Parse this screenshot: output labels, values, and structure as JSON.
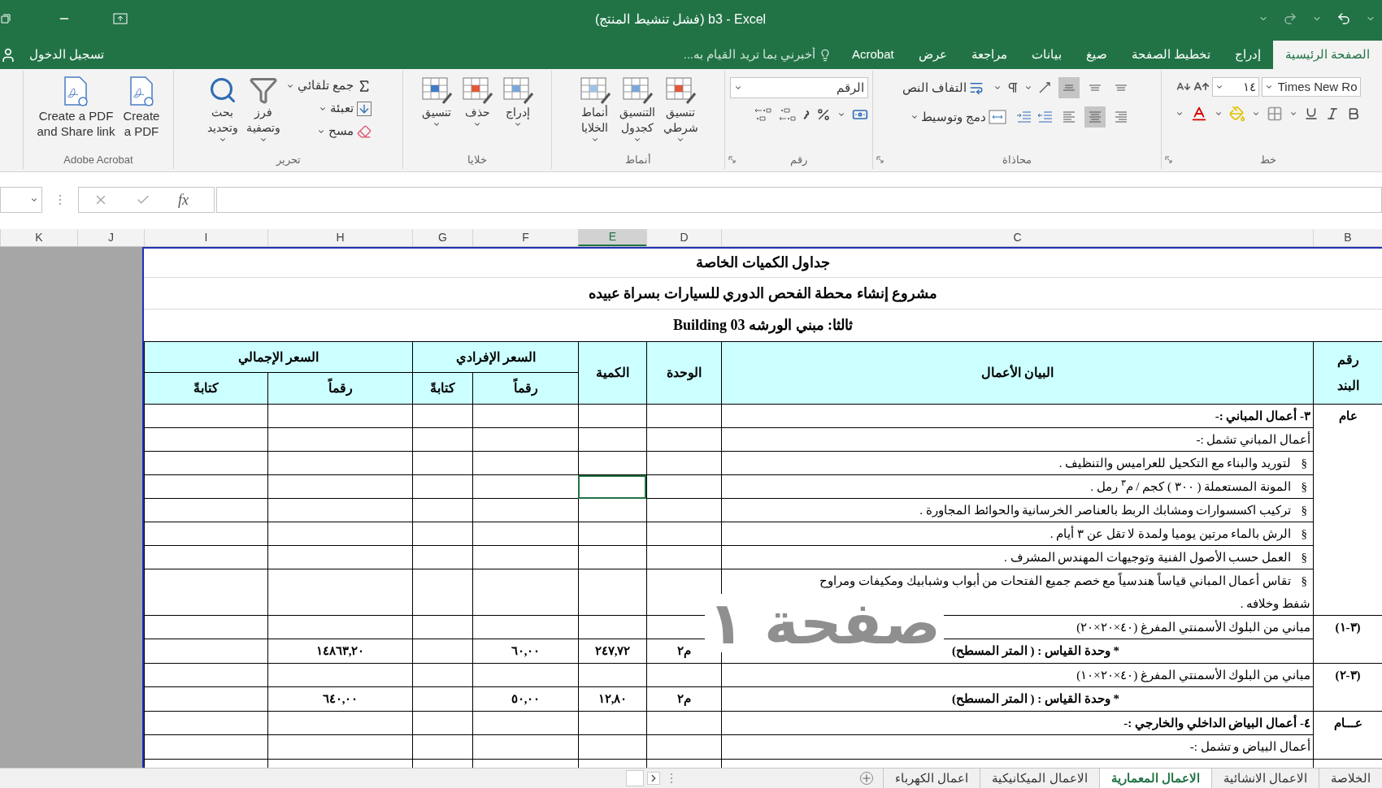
{
  "window": {
    "title": "(فشل تنشيط المنتج) b3 - Excel"
  },
  "ribbon_tabs": [
    {
      "label": "الصفحة الرئيسية",
      "selected": true
    },
    {
      "label": "إدراج",
      "selected": false
    },
    {
      "label": "تخطيط الصفحة",
      "selected": false
    },
    {
      "label": "صيغ",
      "selected": false
    },
    {
      "label": "بيانات",
      "selected": false
    },
    {
      "label": "مراجعة",
      "selected": false
    },
    {
      "label": "عرض",
      "selected": false
    },
    {
      "label": "Acrobat",
      "selected": false
    }
  ],
  "tell_me": {
    "placeholder": "أخبرني بما تريد القيام به..."
  },
  "sign_in": "تسجيل الدخول",
  "font_group": {
    "label": "خط",
    "font_name": "Times New Ro",
    "font_size": "١٤"
  },
  "alignment_group": {
    "label": "محاذاة",
    "wrap_text": "التفاف النص",
    "merge_center": "دمج وتوسيط",
    "vertical": [
      {
        "kind": "top",
        "selected": false
      },
      {
        "kind": "middle",
        "selected": false
      },
      {
        "kind": "bottom",
        "selected": true
      }
    ],
    "horizontal": [
      {
        "kind": "right",
        "selected": false
      },
      {
        "kind": "center",
        "selected": true
      },
      {
        "kind": "left",
        "selected": false
      }
    ]
  },
  "number_group": {
    "label": "رقم",
    "format": "الرقم"
  },
  "styles_group": {
    "label": "أنماط",
    "buttons": [
      "تنسيق\nشرطي",
      "التنسيق\nكجدول",
      "أنماط\nالخلايا"
    ]
  },
  "cells_group": {
    "label": "خلايا",
    "buttons": [
      "إدراج",
      "حذف",
      "تنسيق"
    ]
  },
  "editing_group": {
    "label": "تحرير",
    "small_buttons": [
      "جمع تلقائي",
      "تعبئة",
      "مسح"
    ],
    "big_buttons": [
      "فرز\nوتصفية",
      "بحث\nوتحديد"
    ]
  },
  "acrobat_group": {
    "label": "Adobe Acrobat",
    "buttons": [
      "Create\na PDF",
      "Create a PDF\nand Share link"
    ]
  },
  "formula_bar": {
    "function_label": "fx"
  },
  "columns": [
    {
      "label": "B",
      "selected": false
    },
    {
      "label": "C",
      "selected": false
    },
    {
      "label": "D",
      "selected": false
    },
    {
      "label": "E",
      "selected": true
    },
    {
      "label": "F",
      "selected": false
    },
    {
      "label": "G",
      "selected": false
    },
    {
      "label": "H",
      "selected": false
    },
    {
      "label": "I",
      "selected": false
    },
    {
      "label": "J",
      "selected": false
    },
    {
      "label": "K",
      "selected": false
    }
  ],
  "sheet": {
    "titles": [
      "جداول الكميات الخاصة",
      "مشروع إنشاء محطة الفحص الدوري للسيارات بسراة عبيده",
      "ثالثا: مبني الورشه Building 03"
    ],
    "header": {
      "item_no": "رقم\nالبند",
      "description": "البيان الأعمال",
      "unit": "الوحدة",
      "quantity": "الكمية",
      "unit_price": "السعر الإفرادي",
      "total": "السعر الإجمالي",
      "sub_headings": [
        "رقماً",
        "كتابةً",
        "رقماً",
        "كتابةً"
      ]
    },
    "groups": [
      {
        "number": "عام",
        "lines": [
          {
            "kind": "heading",
            "text": "٣-  أعمال المباني :-",
            "active": false
          },
          {
            "kind": "text",
            "text": "أعمال المباني تشمل :-",
            "active": false
          },
          {
            "kind": "bullet",
            "marker": "§",
            "text": "لتوريد والبناء مع التكحيل للعراميس والتنظيف .",
            "active": false
          },
          {
            "kind": "bullet",
            "marker": "§",
            "text": "المونة المستعملة ( ٣٠٠ ) كجم / م$^{٣}$ رمل .",
            "active": true
          },
          {
            "kind": "bullet",
            "marker": "§",
            "text": "تركيب اكسسوارات ومشابك الربط بالعناصر الخرسانية والحوائط المجاورة .",
            "active": false
          },
          {
            "kind": "bullet",
            "marker": "§",
            "text": "الرش بالماء مرتين يوميا ولمدة لا تقل عن ٣ أيام .",
            "active": false
          },
          {
            "kind": "bullet",
            "marker": "§",
            "text": "العمل حسب الأصول الفنية وتوجيهات المهندس المشرف .",
            "active": false
          },
          {
            "kind": "bullet",
            "marker": "§",
            "text": "تقاس أعمال المباني قياساً هندسياً مع خصم جميع الفتحات من أبواب وشبابيك ومكيفات ومراوح شفط وخلافه .",
            "active": false
          }
        ]
      },
      {
        "number": "(٣-١)",
        "unit": "م٢",
        "quantity": "٢٤٧,٧٢",
        "unit_price": "٦٠,٠٠",
        "total": "١٤٨٦٣,٢٠",
        "lines": [
          {
            "kind": "text",
            "text": "مباني من البلوك الأسمنتي المفرغ (٤٠×٢٠×٢٠)",
            "active": false
          },
          {
            "kind": "measure",
            "text": "* وحدة القياس : ( المتر المسطح)",
            "active": false
          }
        ]
      },
      {
        "number": "(٣-٢)",
        "unit": "م٢",
        "quantity": "١٢,٨٠",
        "unit_price": "٥٠,٠٠",
        "total": "٦٤٠,٠٠",
        "lines": [
          {
            "kind": "text",
            "text": "مباني من البلوك الأسمنتي المفرغ (٤٠×٢٠×١٠)",
            "active": false
          },
          {
            "kind": "measure",
            "text": "* وحدة القياس : ( المتر المسطح)",
            "active": false
          }
        ]
      },
      {
        "number": "عـــام",
        "lines": [
          {
            "kind": "heading",
            "text": "٤-  أعمال البياض الداخلي والخارجي :-",
            "active": false
          },
          {
            "kind": "text",
            "text": "أعمال البياض و  تشمل :-",
            "active": false
          }
        ]
      }
    ]
  },
  "page_label": "صفحة ١",
  "sheet_tabs": [
    {
      "label": "الخلاصة",
      "selected": false
    },
    {
      "label": "الاعمال الانشائية",
      "selected": false
    },
    {
      "label": "الاعمال المعمارية",
      "selected": true
    },
    {
      "label": "الاعمال الميكانيكية",
      "selected": false
    },
    {
      "label": "اعمال الكهرباء",
      "selected": false
    }
  ]
}
